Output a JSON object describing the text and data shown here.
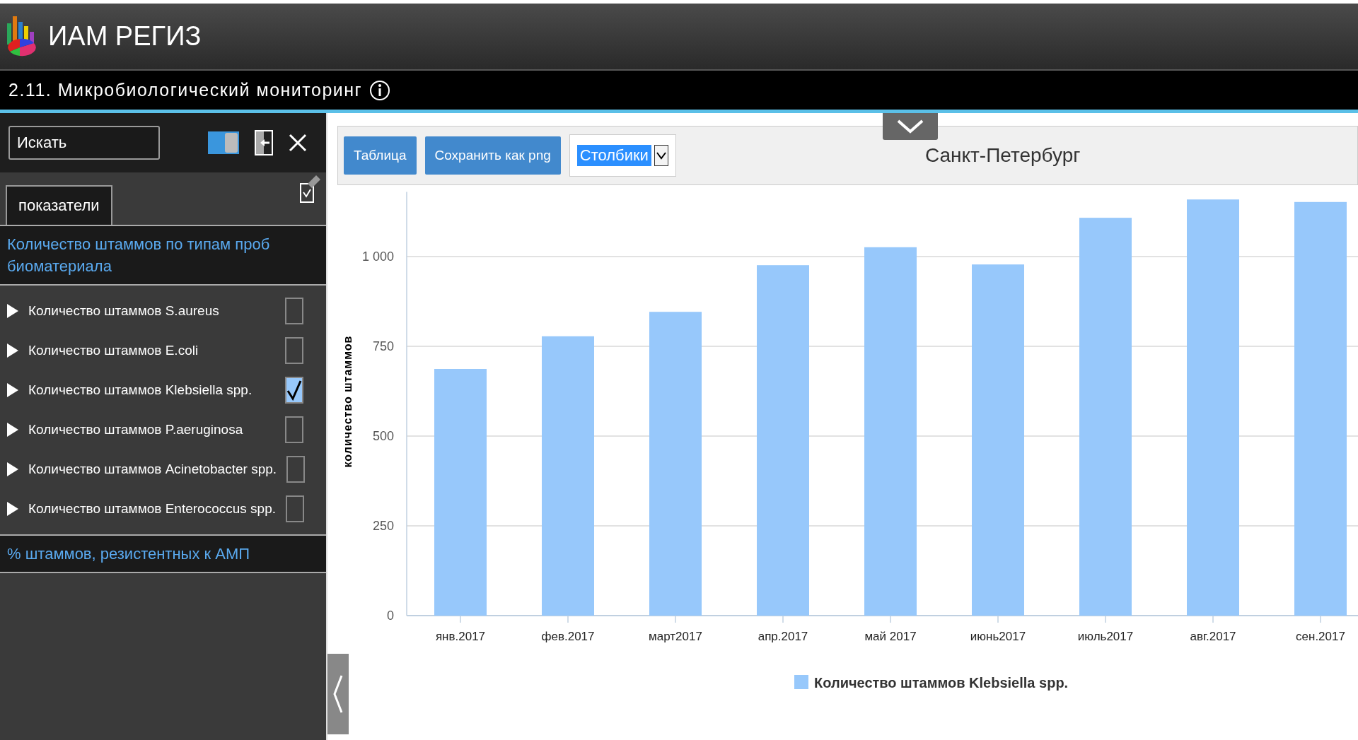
{
  "app": {
    "title": "ИАМ РЕГИЗ"
  },
  "page": {
    "title": "2.11. Микробиологический мониторинг"
  },
  "sidebar": {
    "search": {
      "placeholder": "Искать"
    },
    "toggle": {
      "on": true
    },
    "tabs": [
      {
        "label": "показатели",
        "selected": true
      }
    ],
    "groups": [
      {
        "title": "Количество штаммов по типам проб биоматериала",
        "expanded": true,
        "items": [
          {
            "label": "Количество штаммов S.aureus",
            "expanded": false,
            "checked": false
          },
          {
            "label": "Количество штаммов E.coli",
            "expanded": false,
            "checked": false
          },
          {
            "label": "Количество штаммов Klebsiella spp.",
            "expanded": false,
            "checked": true
          },
          {
            "label": "Количество штаммов P.aeruginosa",
            "expanded": false,
            "checked": false
          },
          {
            "label": "Количество штаммов Acinetobacter spp.",
            "expanded": false,
            "checked": false
          },
          {
            "label": "Количество штаммов Enterococcus spp.",
            "expanded": false,
            "checked": false
          }
        ]
      },
      {
        "title": "% штаммов, резистентных к АМП",
        "expanded": false
      }
    ]
  },
  "toolbar": {
    "buttons": [
      "Таблица",
      "Сохранить как png"
    ],
    "chart_type": "Столбики",
    "region": "Санкт-Петербург"
  },
  "chart_data": {
    "type": "bar",
    "ylabel": "количество штаммов",
    "categories": [
      "янв.2017",
      "фев.2017",
      "март2017",
      "апр.2017",
      "май 2017",
      "июнь2017",
      "июль2017",
      "авг.2017",
      "сен.2017"
    ],
    "series": [
      {
        "name": "Количество штаммов Klebsiella spp.",
        "color": "#97c8fb",
        "values": [
          687,
          778,
          846,
          976,
          1026,
          978,
          1108,
          1159,
          1152
        ]
      }
    ],
    "ylim": [
      0,
      1180
    ],
    "grid": true,
    "yticks": [
      0,
      250,
      500,
      750,
      {
        "value": 1000,
        "label": "1 000"
      }
    ]
  }
}
